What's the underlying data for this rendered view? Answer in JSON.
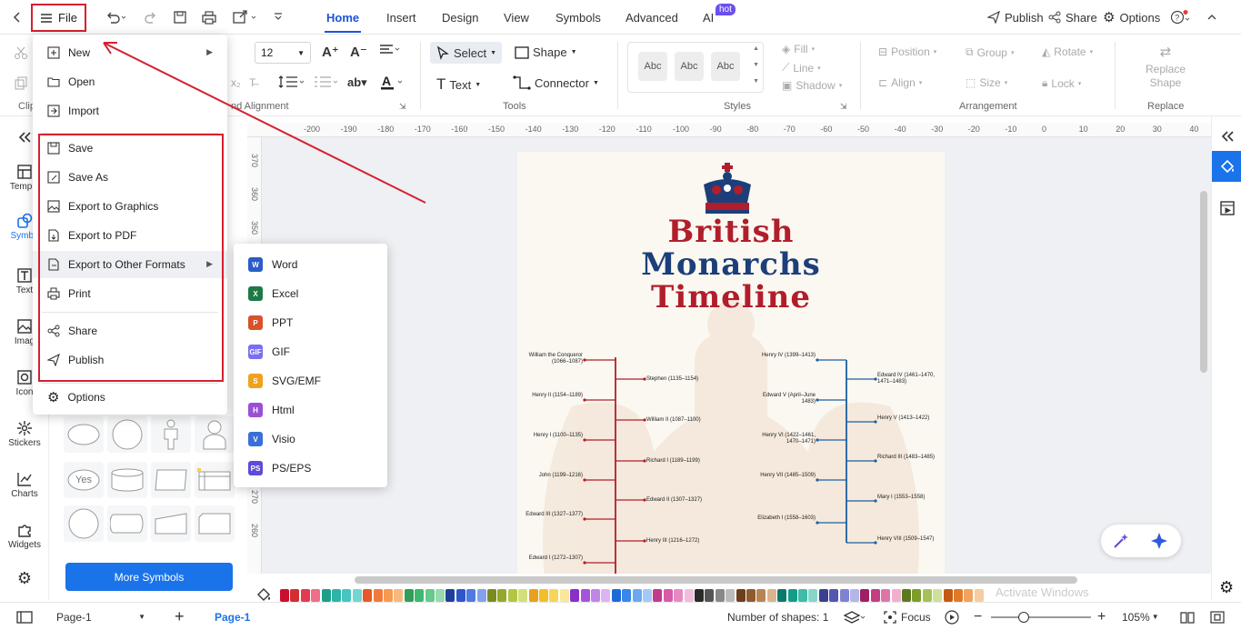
{
  "topbar": {
    "file_label": "File",
    "tabs": [
      "Home",
      "Insert",
      "Design",
      "View",
      "Symbols",
      "Advanced",
      "AI"
    ],
    "active_tab": "Home",
    "hot_badge": "hot",
    "publish": "Publish",
    "share": "Share",
    "options": "Options"
  },
  "ribbon": {
    "font_size": "12",
    "select": "Select",
    "shape": "Shape",
    "text": "Text",
    "connector": "Connector",
    "fill": "Fill",
    "line": "Line",
    "shadow": "Shadow",
    "style_samples": [
      "Abc",
      "Abc",
      "Abc"
    ],
    "position": "Position",
    "group": "Group",
    "rotate": "Rotate",
    "align": "Align",
    "size": "Size",
    "lock": "Lock",
    "replace_shape": "Replace Shape",
    "groups": {
      "clipboard": "Clip",
      "font_alignment": "nd Alignment",
      "tools": "Tools",
      "styles": "Styles",
      "arrangement": "Arrangement",
      "replace": "Replace"
    }
  },
  "rail": {
    "items": [
      "Templa",
      "Symbo",
      "Text",
      "Imag",
      "Icon",
      "Stickers",
      "Charts",
      "Widgets"
    ]
  },
  "library": {
    "more_symbols": "More Symbols",
    "yes_shape": "Yes"
  },
  "ruler": {
    "h_ticks": [
      "-200",
      "-190",
      "-180",
      "-170",
      "-160",
      "-150",
      "-140",
      "-130",
      "-120",
      "-110",
      "-100",
      "-90",
      "-80",
      "-70",
      "-60",
      "-50",
      "-40",
      "-30",
      "-20",
      "-10",
      "0",
      "10",
      "20",
      "30",
      "40"
    ],
    "v_ticks": [
      "370",
      "360",
      "350",
      "340",
      "330",
      "320",
      "310",
      "300",
      "290",
      "280",
      "270",
      "260"
    ]
  },
  "file_menu": {
    "items": [
      {
        "label": "New",
        "icon": "new-icon",
        "submenu": true
      },
      {
        "label": "Open",
        "icon": "folder-icon"
      },
      {
        "label": "Import",
        "icon": "import-icon"
      },
      {
        "label": "Save",
        "icon": "save-icon"
      },
      {
        "label": "Save As",
        "icon": "save-as-icon"
      },
      {
        "label": "Export to Graphics",
        "icon": "image-icon"
      },
      {
        "label": "Export to PDF",
        "icon": "pdf-icon"
      },
      {
        "label": "Export to Other Formats",
        "icon": "export-icon",
        "submenu": true
      },
      {
        "label": "Print",
        "icon": "print-icon"
      },
      {
        "label": "Share",
        "icon": "share-icon"
      },
      {
        "label": "Publish",
        "icon": "publish-icon"
      },
      {
        "label": "Options",
        "icon": "gear-icon"
      }
    ]
  },
  "export_submenu": {
    "items": [
      {
        "label": "Word",
        "icon": "word-icon",
        "abbr": "W",
        "color": "#2b5cc8"
      },
      {
        "label": "Excel",
        "icon": "excel-icon",
        "abbr": "X",
        "color": "#1e7a45"
      },
      {
        "label": "PPT",
        "icon": "ppt-icon",
        "abbr": "P",
        "color": "#d8522a"
      },
      {
        "label": "GIF",
        "icon": "gif-icon",
        "abbr": "GIF",
        "color": "#7b6ef0"
      },
      {
        "label": "SVG/EMF",
        "icon": "svg-icon",
        "abbr": "S",
        "color": "#f0a21e"
      },
      {
        "label": "Html",
        "icon": "html-icon",
        "abbr": "H",
        "color": "#9b4fd8"
      },
      {
        "label": "Visio",
        "icon": "visio-icon",
        "abbr": "V",
        "color": "#3a6fd8"
      },
      {
        "label": "PS/EPS",
        "icon": "ps-icon",
        "abbr": "PS",
        "color": "#5e4bd8"
      }
    ]
  },
  "diagram": {
    "title_line1": "British",
    "title_line2": "Monarchs",
    "title_line3": "Timeline",
    "left_outer": [
      "William the Conqueror (1066–1087)",
      "Henry II (1154–1189)",
      "Henry I (1100–1135)",
      "John (1199–1216)",
      "Edward III (1327–1377)",
      "Edward I (1272–1307)"
    ],
    "left_inner": [
      "Stephen (1135–1154)",
      "William II (1087–1100)",
      "Richard I (1189–1199)",
      "Edward II (1307–1327)",
      "Henry III (1216–1272)"
    ],
    "right_outer": [
      "Henry IV (1399–1413)",
      "Edward V (April–June 1483)",
      "Henry VI (1422–1461, 1470–1471)",
      "Henry VII (1485–1509)",
      "Elizabeth I (1558–1603)"
    ],
    "right_inner": [
      "Edward IV (1461–1470, 1471–1483)",
      "Henry V (1413–1422)",
      "Richard III (1483–1485)",
      "Mary I (1553–1558)",
      "Henry VIII (1509–1547)"
    ],
    "red": "#b11e2b",
    "blue": "#1c5fa0"
  },
  "watermark": "Activate Windows",
  "status": {
    "page_tab": "Page-1",
    "active_page": "Page-1",
    "shapes": "Number of shapes: 1",
    "focus": "Focus",
    "zoom": "105%"
  },
  "palette": [
    "#c8102e",
    "#d32f2f",
    "#e53950",
    "#ef6f88",
    "#1e9e8a",
    "#2bb5a6",
    "#46c6c0",
    "#6fd6d2",
    "#e8572a",
    "#f07a3a",
    "#f59a4e",
    "#f7b97c",
    "#2e9e5a",
    "#3fb86f",
    "#67c98b",
    "#94dbad",
    "#1f3f9a",
    "#2d57c8",
    "#4f7ae0",
    "#83a1ee",
    "#7b8b1f",
    "#93a92a",
    "#b4c544",
    "#d3df7b",
    "#e6a21a",
    "#f0c02a",
    "#f5d65c",
    "#f9e79b",
    "#8a2fc8",
    "#a653db",
    "#c184e8",
    "#dcb3f3",
    "#1e6ad8",
    "#3887ea",
    "#6ba8f1",
    "#a4c9f7",
    "#c23a8e",
    "#d65ca8",
    "#e68ac2",
    "#f2bcdc",
    "#2a2a2a",
    "#555555",
    "#888888",
    "#bbbbbb",
    "#6b3e1e",
    "#8f5a2e",
    "#b88455",
    "#d9b48e",
    "#0b7a6b",
    "#139c88",
    "#40bba7",
    "#87d6c8",
    "#3a3f8f",
    "#5257b0",
    "#7f83cf",
    "#b3b6e6",
    "#9e1f63",
    "#c23d84",
    "#dd75a9",
    "#efb0cf",
    "#5b7a1e",
    "#7c9c2c",
    "#a5c257",
    "#cfe09a",
    "#c45a12",
    "#e07a26",
    "#f0a35f",
    "#f7cca0"
  ]
}
